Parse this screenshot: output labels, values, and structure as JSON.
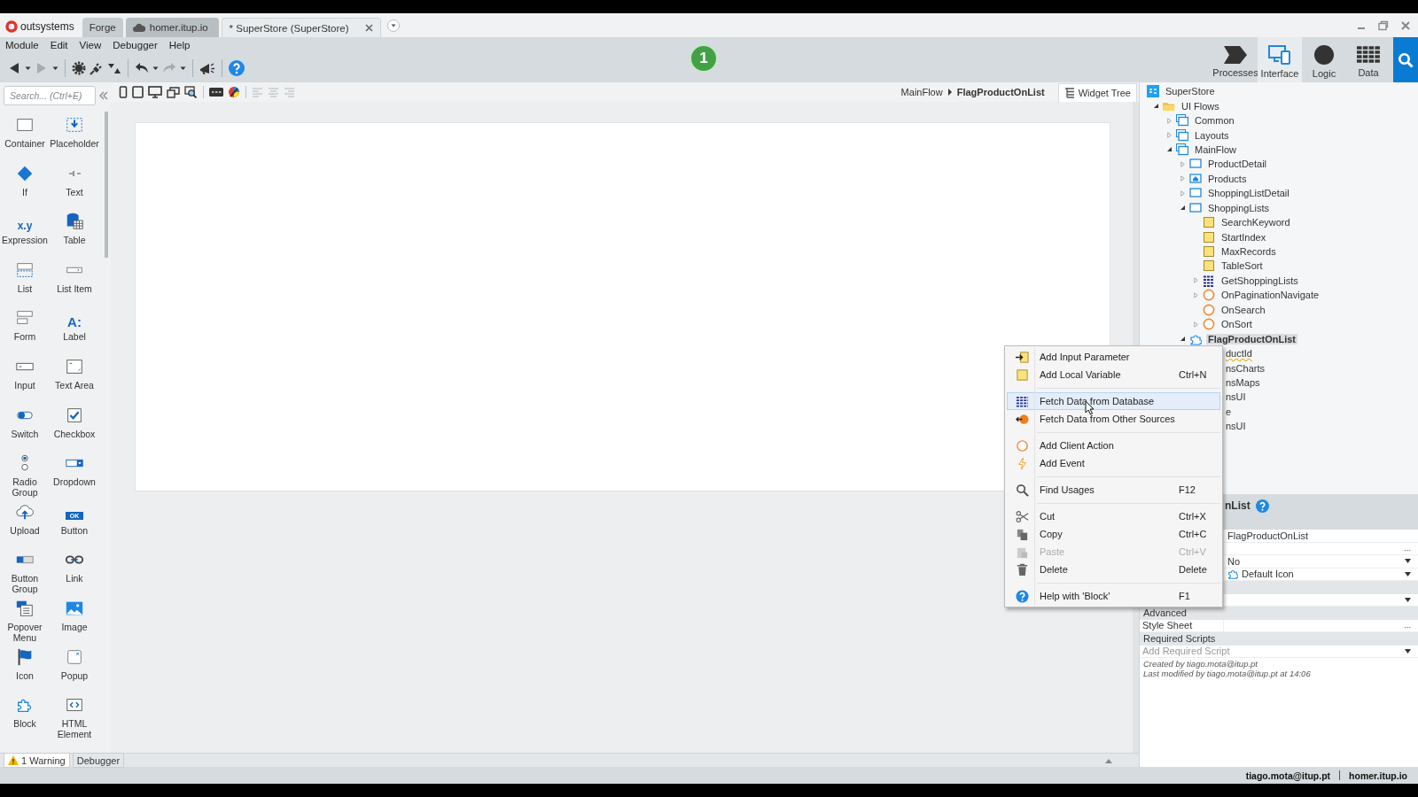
{
  "tabs_bar": {
    "logo": "outsystems",
    "tabs": [
      {
        "label": "Forge",
        "kind": "plain",
        "selected": false
      },
      {
        "label": "homer.itup.io",
        "kind": "server",
        "selected": false
      },
      {
        "label": "* SuperStore (SuperStore)",
        "kind": "module",
        "selected": true
      }
    ]
  },
  "menu_bar": [
    "Module",
    "Edit",
    "View",
    "Debugger",
    "Help"
  ],
  "toolbar": [
    {
      "kind": "back",
      "disabled": false
    },
    {
      "kind": "caret",
      "disabled": false
    },
    {
      "kind": "forward",
      "disabled": true
    },
    {
      "kind": "caret",
      "disabled": false
    },
    {
      "kind": "separator"
    },
    {
      "kind": "gear",
      "disabled": false
    },
    {
      "kind": "plug",
      "disabled": false
    },
    {
      "kind": "transfer",
      "disabled": false
    },
    {
      "kind": "separator"
    },
    {
      "kind": "undo",
      "disabled": false
    },
    {
      "kind": "caret",
      "disabled": false
    },
    {
      "kind": "redo",
      "disabled": true
    },
    {
      "kind": "caret",
      "disabled": false
    },
    {
      "kind": "separator"
    },
    {
      "kind": "megaphone",
      "disabled": false
    },
    {
      "kind": "separator"
    },
    {
      "kind": "help",
      "disabled": false
    }
  ],
  "badge": "1",
  "nav": [
    {
      "label": "Processes",
      "kind": "processes",
      "selected": false
    },
    {
      "label": "Interface",
      "kind": "interface",
      "selected": true
    },
    {
      "label": "Logic",
      "kind": "logic",
      "selected": false
    },
    {
      "label": "Data",
      "kind": "data",
      "selected": false
    },
    {
      "kind": "search",
      "selected": false
    }
  ],
  "toolbox": {
    "search_placeholder": "Search... (Ctrl+E)",
    "items": [
      {
        "label": "Container",
        "kind": "container"
      },
      {
        "label": "If",
        "kind": "if"
      },
      {
        "label": "Expression",
        "kind": "expression",
        "glyph": "x.y"
      },
      {
        "label": "List",
        "kind": "list"
      },
      {
        "label": "Form",
        "kind": "form"
      },
      {
        "label": "Input",
        "kind": "input"
      },
      {
        "label": "Switch",
        "kind": "switch"
      },
      {
        "label": "Radio Group",
        "kind": "radio-group"
      },
      {
        "label": "Upload",
        "kind": "upload"
      },
      {
        "label": "Button Group",
        "kind": "button-group"
      },
      {
        "label": "Popover Menu",
        "kind": "popover-menu"
      },
      {
        "label": "Icon",
        "kind": "icon"
      },
      {
        "label": "Block",
        "kind": "block"
      },
      {
        "label": "Placeholder",
        "kind": "placeholder"
      },
      {
        "label": "Text",
        "kind": "text"
      },
      {
        "label": "Table",
        "kind": "table"
      },
      {
        "label": "List Item",
        "kind": "list-item"
      },
      {
        "label": "Label",
        "kind": "label",
        "glyph": "A:"
      },
      {
        "label": "Text Area",
        "kind": "text-area"
      },
      {
        "label": "Checkbox",
        "kind": "checkbox"
      },
      {
        "label": "Dropdown",
        "kind": "dropdown"
      },
      {
        "label": "Button",
        "kind": "button",
        "glyph": "OK"
      },
      {
        "label": "Link",
        "kind": "link"
      },
      {
        "label": "Image",
        "kind": "image"
      },
      {
        "label": "Popup",
        "kind": "popup"
      },
      {
        "label": "HTML Element",
        "kind": "html-element"
      }
    ]
  },
  "designer": {
    "view_tools": [
      {
        "kind": "phone",
        "disabled": false
      },
      {
        "kind": "tablet",
        "disabled": false
      },
      {
        "kind": "desktop",
        "disabled": false
      },
      {
        "kind": "multi",
        "disabled": false
      },
      {
        "kind": "preview",
        "disabled": false
      },
      {
        "kind": "separator"
      },
      {
        "kind": "css",
        "disabled": false
      },
      {
        "kind": "theme",
        "disabled": false
      },
      {
        "kind": "separator"
      },
      {
        "kind": "align-left",
        "disabled": true
      },
      {
        "kind": "align-center",
        "disabled": true
      },
      {
        "kind": "align-right",
        "disabled": true
      }
    ],
    "breadcrumb": {
      "parent": "MainFlow",
      "current": "FlagProductOnList"
    },
    "widget_tree_button": "Widget Tree"
  },
  "bottom_tabs": [
    {
      "label": "1 Warning",
      "kind": "warning",
      "selected": true
    },
    {
      "label": "Debugger",
      "kind": "plain",
      "selected": false
    }
  ],
  "tree": {
    "items": [
      {
        "name": "SuperStore",
        "kind": "app",
        "selected": false,
        "children": [
          {
            "name": "UI Flows",
            "kind": "folder",
            "expanded": true,
            "selected": false,
            "children": [
              {
                "name": "Common",
                "kind": "flow",
                "expanded": false,
                "selected": false
              },
              {
                "name": "Layouts",
                "kind": "flow",
                "expanded": false,
                "selected": false
              },
              {
                "name": "MainFlow",
                "kind": "flow",
                "expanded": true,
                "selected": false,
                "children": [
                  {
                    "name": "ProductDetail",
                    "kind": "screen",
                    "expanded": false,
                    "selected": false
                  },
                  {
                    "name": "Products",
                    "kind": "home-screen",
                    "expanded": false,
                    "selected": false
                  },
                  {
                    "name": "ShoppingListDetail",
                    "kind": "screen",
                    "expanded": false,
                    "selected": false
                  },
                  {
                    "name": "ShoppingLists",
                    "kind": "screen",
                    "expanded": true,
                    "selected": false,
                    "children": [
                      {
                        "name": "SearchKeyword",
                        "kind": "variable",
                        "selected": false
                      },
                      {
                        "name": "StartIndex",
                        "kind": "variable",
                        "selected": false
                      },
                      {
                        "name": "MaxRecords",
                        "kind": "variable",
                        "selected": false
                      },
                      {
                        "name": "TableSort",
                        "kind": "variable",
                        "selected": false
                      },
                      {
                        "name": "GetShoppingLists",
                        "kind": "aggregate",
                        "expanded": false,
                        "selected": false
                      },
                      {
                        "name": "OnPaginationNavigate",
                        "kind": "action",
                        "expanded": false,
                        "selected": false
                      },
                      {
                        "name": "OnSearch",
                        "kind": "action",
                        "selected": false
                      },
                      {
                        "name": "OnSort",
                        "kind": "action",
                        "expanded": false,
                        "selected": false
                      }
                    ]
                  },
                  {
                    "name": "FlagProductOnList",
                    "kind": "block",
                    "expanded": true,
                    "selected": true,
                    "children": [
                      {
                        "name": "ductId",
                        "kind": "partial",
                        "warning": true,
                        "selected": false
                      },
                      {
                        "name": "nsCharts",
                        "kind": "partial",
                        "warning": false,
                        "selected": false
                      },
                      {
                        "name": "nsMaps",
                        "kind": "partial",
                        "warning": false,
                        "selected": false
                      },
                      {
                        "name": "nsUI",
                        "kind": "partial",
                        "warning": false,
                        "selected": false
                      },
                      {
                        "name": "e",
                        "kind": "partial",
                        "warning": false,
                        "selected": false
                      },
                      {
                        "name": "nsUI",
                        "kind": "partial",
                        "warning": false,
                        "selected": false
                      }
                    ]
                  }
                ]
              }
            ]
          }
        ]
      }
    ]
  },
  "properties": {
    "title": "nList",
    "rows": [
      {
        "kind": "field",
        "value": "FlagProductOnList"
      },
      {
        "kind": "field",
        "button": "..."
      },
      {
        "kind": "dropdown",
        "value": "No"
      },
      {
        "kind": "icon-dropdown",
        "value": "Default Icon"
      },
      {
        "kind": "section"
      },
      {
        "kind": "dropdown"
      },
      {
        "kind": "section",
        "label": "Advanced"
      },
      {
        "kind": "field",
        "label": "Style Sheet",
        "button": "..."
      },
      {
        "kind": "section",
        "label": "Required Scripts"
      },
      {
        "kind": "wide-dropdown",
        "placeholder": "Add Required Script"
      }
    ],
    "footer": [
      "Created by tiago.mota@itup.pt",
      "Last modified by tiago.mota@itup.pt at 14:06"
    ]
  },
  "context_menu": {
    "groups": [
      [
        {
          "label": "Add Input Parameter",
          "kind": "parameter",
          "selected": false,
          "disabled": false
        },
        {
          "label": "Add Local Variable",
          "kind": "variable",
          "shortcut": "Ctrl+N",
          "selected": false,
          "disabled": false
        }
      ],
      [
        {
          "label": "Fetch Data from Database",
          "kind": "aggregate",
          "selected": true,
          "disabled": false
        },
        {
          "label": "Fetch Data from Other Sources",
          "kind": "fetch",
          "selected": false,
          "disabled": false
        }
      ],
      [
        {
          "label": "Add Client Action",
          "kind": "action",
          "selected": false,
          "disabled": false
        },
        {
          "label": "Add Event",
          "kind": "event",
          "selected": false,
          "disabled": false
        }
      ],
      [
        {
          "label": "Find Usages",
          "kind": "search",
          "shortcut": "F12",
          "selected": false,
          "disabled": false
        }
      ],
      [
        {
          "label": "Cut",
          "kind": "cut",
          "shortcut": "Ctrl+X",
          "selected": false,
          "disabled": false
        },
        {
          "label": "Copy",
          "kind": "copy",
          "shortcut": "Ctrl+C",
          "selected": false,
          "disabled": false
        },
        {
          "label": "Paste",
          "kind": "paste",
          "shortcut": "Ctrl+V",
          "selected": false,
          "disabled": true
        },
        {
          "label": "Delete",
          "kind": "delete",
          "shortcut": "Delete",
          "selected": false,
          "disabled": false
        }
      ],
      [
        {
          "label": "Help with 'Block'",
          "kind": "help",
          "shortcut": "F1",
          "selected": false,
          "disabled": false
        }
      ]
    ]
  },
  "status_bar": {
    "user": "tiago.mota@itup.pt",
    "server": "homer.itup.io"
  }
}
